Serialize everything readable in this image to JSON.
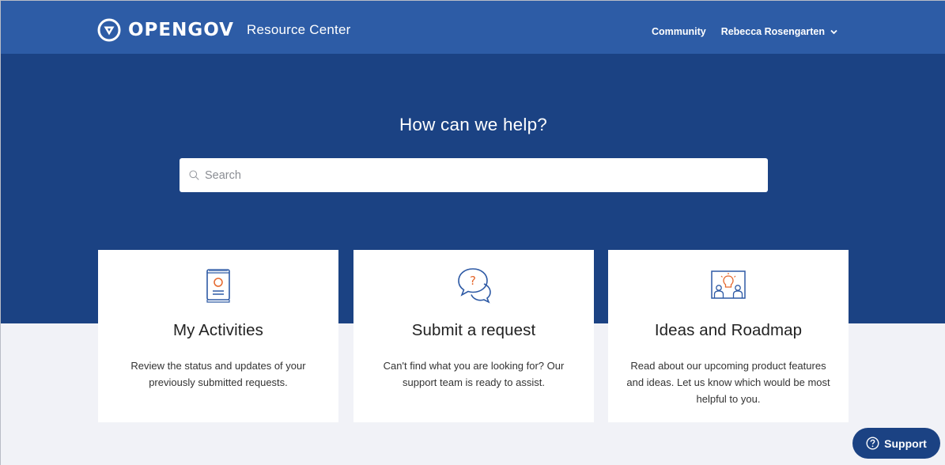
{
  "header": {
    "brand_name": "OPENGOV",
    "brand_subtitle": "Resource Center",
    "community_link": "Community",
    "user_name": "Rebecca Rosengarten"
  },
  "hero": {
    "title": "How can we help?",
    "search_placeholder": "Search",
    "search_value": ""
  },
  "cards": [
    {
      "title": "My Activities",
      "description": "Review the status and updates of your previously submitted requests.",
      "icon": "book-icon"
    },
    {
      "title": "Submit a request",
      "description": "Can't find what you are looking for? Our support team is ready to assist.",
      "icon": "question-chat-icon"
    },
    {
      "title": "Ideas and Roadmap",
      "description": "Read about our upcoming product features and ideas. Let us know which would be most helpful to you.",
      "icon": "idea-people-icon"
    }
  ],
  "support_button": {
    "label": "Support",
    "icon": "question-circle-icon"
  },
  "colors": {
    "header_bg": "#2d5ca6",
    "hero_bg": "#1b4283",
    "page_bg": "#f1f2f7",
    "icon_blue": "#2e5aa5",
    "icon_accent": "#e5672c"
  }
}
